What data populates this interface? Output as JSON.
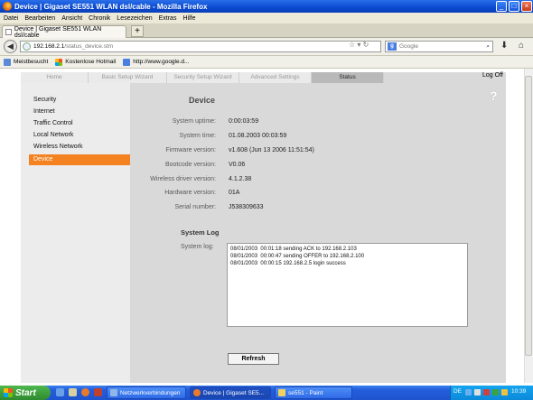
{
  "window": {
    "title": "Device | Gigaset SE551 WLAN dsl/cable - Mozilla Firefox"
  },
  "menu": [
    "Datei",
    "Bearbeiten",
    "Ansicht",
    "Chronik",
    "Lesezeichen",
    "Extras",
    "Hilfe"
  ],
  "tab": {
    "title": "Device | Gigaset SE551 WLAN dsl/cable",
    "new_tab": "+"
  },
  "nav": {
    "url_host": "192.168.2.1",
    "url_path": "/status_device.stm",
    "search_placeholder": "Google"
  },
  "bookmarks": [
    "Meistbesucht",
    "Kostenlose Hotmail",
    "http://www.google.d..."
  ],
  "router": {
    "tabs": [
      "Home",
      "Basic Setup Wizard",
      "Security Setup Wizard",
      "Advanced Settings",
      "Status"
    ],
    "logoff": "Log Off",
    "help": "?",
    "sidebar": [
      "Security",
      "Internet",
      "Traffic Control",
      "Local Network",
      "Wireless Network",
      "Device"
    ],
    "page_title": "Device",
    "fields": [
      {
        "label": "System uptime:",
        "value": "0:00:03:59"
      },
      {
        "label": "System time:",
        "value": "01.08.2003 00:03:59"
      },
      {
        "label": "Firmware version:",
        "value": "v1.608 (Jun 13 2006 11:51:54)"
      },
      {
        "label": "Bootcode version:",
        "value": "V0.06"
      },
      {
        "label": "Wireless driver version:",
        "value": "4.1.2.38"
      },
      {
        "label": "Hardware version:",
        "value": "01A"
      },
      {
        "label": "Serial number:",
        "value": "J538309633"
      }
    ],
    "syslog_title": "System Log",
    "syslog_label": "System log:",
    "syslog_lines": [
      "08/01/2003  00:01:18 sending ACK to 192.168.2.103",
      "08/01/2003  00:00:47 sending OFFER to 192.168.2.100",
      "08/01/2003  00:00:15 192.168.2.5 login success"
    ],
    "refresh": "Refresh"
  },
  "taskbar": {
    "start": "Start",
    "tasks": [
      "Netzwerkverbindungen",
      "Device | Gigaset SE5...",
      "se551 - Paint"
    ],
    "lang": "DE",
    "clock": "10:39"
  },
  "colors": {
    "accent": "#f58220",
    "titlebar": "#0a4ad0",
    "panel": "#d9d9d9"
  }
}
